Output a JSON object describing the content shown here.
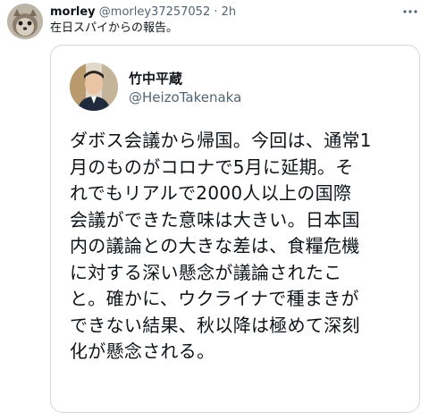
{
  "tweet": {
    "author_name": "morley",
    "author_handle": "@morley37257052",
    "separator": "·",
    "time": "2h",
    "text": "在日スパイからの報告。"
  },
  "quoted_tweet": {
    "author_name": "竹中平蔵",
    "author_handle": "@HeizoTakenaka",
    "lines": [
      "ダボス会議から帰国。今回は、通常1",
      "月のものがコロナで5月に延期。そ",
      "れでもリアルで2000人以上の国際",
      "会議ができた意味は大きい。日本国",
      "内の議論との大きな差は、食糧危機",
      "に対する深い懸念が議論されたこ",
      "と。確かに、ウクライナで種まきが",
      "できない結果、秋以降は極めて深刻",
      "化が懸念される。"
    ]
  },
  "icons": {
    "more": "more-horizontal-icon"
  }
}
